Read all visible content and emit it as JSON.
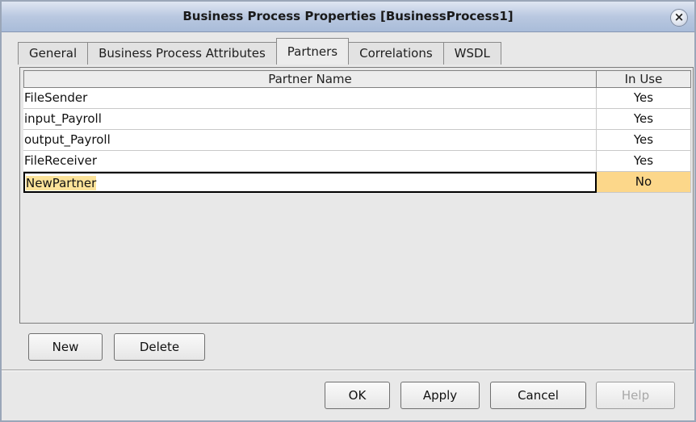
{
  "window": {
    "title": "Business Process Properties [BusinessProcess1]",
    "close_icon": "close-icon"
  },
  "tabs": [
    {
      "label": "General",
      "active": false
    },
    {
      "label": "Business Process Attributes",
      "active": false
    },
    {
      "label": "Partners",
      "active": true
    },
    {
      "label": "Correlations",
      "active": false
    },
    {
      "label": "WSDL",
      "active": false
    }
  ],
  "table": {
    "columns": [
      "Partner Name",
      "In Use"
    ],
    "rows": [
      {
        "name": "FileSender",
        "in_use": "Yes"
      },
      {
        "name": "input_Payroll",
        "in_use": "Yes"
      },
      {
        "name": "output_Payroll",
        "in_use": "Yes"
      },
      {
        "name": "FileReceiver",
        "in_use": "Yes"
      },
      {
        "name": "NewPartner",
        "in_use": "No",
        "editing": true
      }
    ]
  },
  "table_buttons": {
    "new_label": "New",
    "delete_label": "Delete"
  },
  "dialog_buttons": {
    "ok_label": "OK",
    "apply_label": "Apply",
    "cancel_label": "Cancel",
    "help_label": "Help",
    "help_enabled": false
  },
  "colors": {
    "title_gradient_top": "#dfe6f2",
    "title_gradient_bottom": "#a9bcd9",
    "edit_highlight": "#fce39a",
    "inuse_highlight": "#fcd78a"
  }
}
